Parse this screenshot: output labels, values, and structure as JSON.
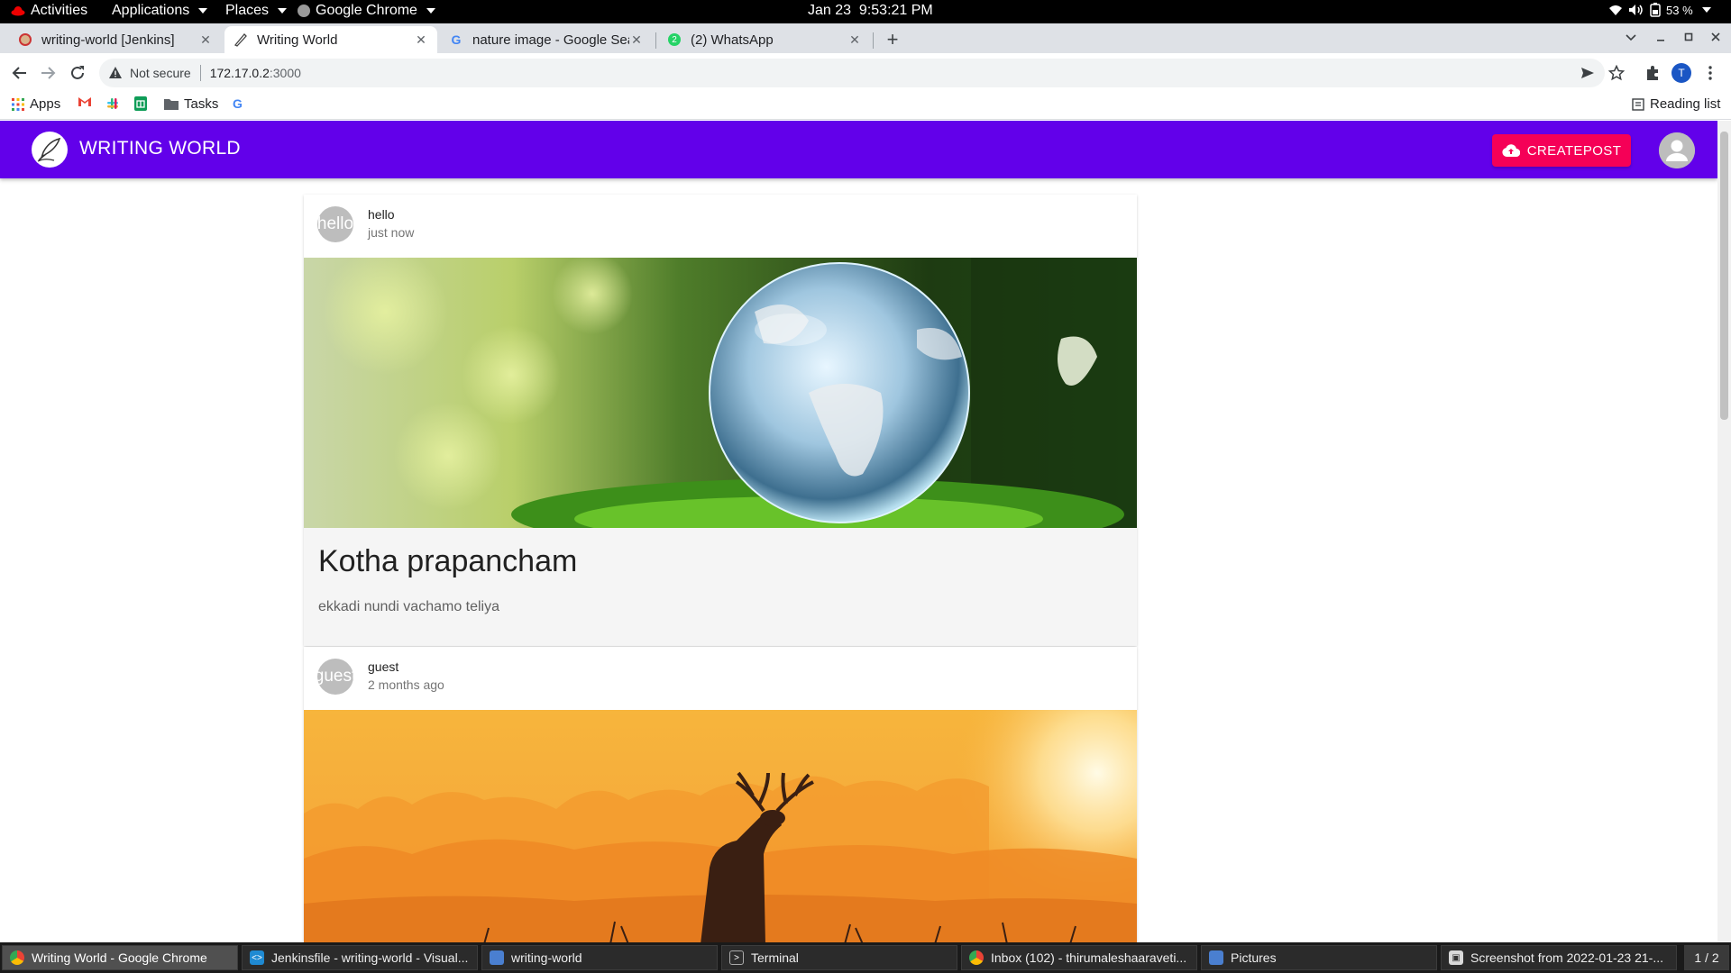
{
  "system_bar": {
    "activities": "Activities",
    "applications": "Applications",
    "places": "Places",
    "app_name": "Google Chrome",
    "clock": "Jan 23  9:53:21 PM",
    "battery": "53 %"
  },
  "browser": {
    "tabs": [
      {
        "title": "writing-world [Jenkins]",
        "icon": "jenkins-icon"
      },
      {
        "title": "Writing World",
        "icon": "pen-icon"
      },
      {
        "title": "nature image - Google Sea",
        "icon": "google-icon"
      },
      {
        "title": "(2) WhatsApp",
        "icon": "whatsapp-icon",
        "badge": "2"
      }
    ],
    "security_label": "Not secure",
    "url_host": "172.17.0.2",
    "url_port": ":3000",
    "bookmarks": {
      "apps": "Apps",
      "tasks": "Tasks",
      "reading_list": "Reading list"
    },
    "profile_initial": "T"
  },
  "app": {
    "brand": "WRITING WORLD",
    "create_button": "CREATEPOST",
    "colors": {
      "primary": "#6200ea",
      "accent": "#f50057"
    }
  },
  "posts": [
    {
      "author": "hello",
      "avatar_alt": "hello",
      "time": "just now",
      "image": "globe-on-moss",
      "title": "Kotha prapancham",
      "description": "ekkadi nundi vachamo teliya"
    },
    {
      "author": "guest",
      "avatar_alt": "guest",
      "time": "2 months ago",
      "image": "deer-sunset"
    }
  ],
  "taskbar": {
    "items": [
      {
        "label": "Writing World - Google Chrome",
        "icon": "chrome-icon"
      },
      {
        "label": "Jenkinsfile - writing-world - Visual...",
        "icon": "vscode-icon"
      },
      {
        "label": "writing-world",
        "icon": "file-manager-icon"
      },
      {
        "label": "Terminal",
        "icon": "terminal-icon"
      },
      {
        "label": "Inbox (102) - thirumaleshaaraveti...",
        "icon": "chrome-icon"
      },
      {
        "label": "Pictures",
        "icon": "file-manager-icon"
      },
      {
        "label": "Screenshot from 2022-01-23 21-...",
        "icon": "image-viewer-icon"
      }
    ],
    "workspace": "1 / 2"
  }
}
